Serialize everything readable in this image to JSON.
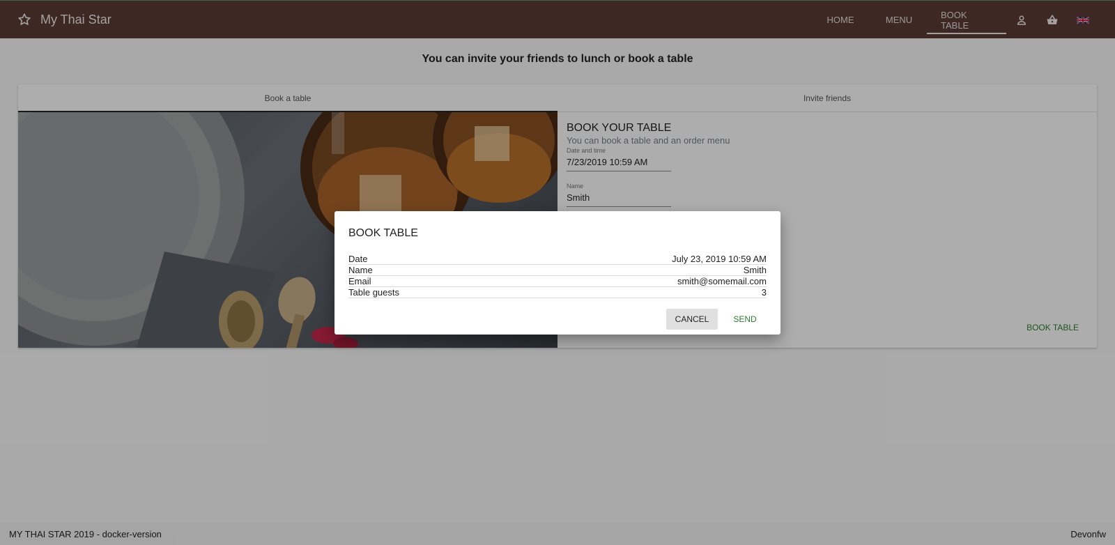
{
  "app": {
    "title": "My Thai Star",
    "nav": [
      "HOME",
      "MENU",
      "BOOK TABLE"
    ],
    "active_nav": "BOOK TABLE",
    "icons": [
      "star-icon",
      "account-icon",
      "basket-icon",
      "uk-flag-icon"
    ]
  },
  "page": {
    "headline": "You can invite your friends to lunch or book a table",
    "tabs": [
      "Book a table",
      "Invite friends"
    ],
    "active_tab": "Book a table"
  },
  "form": {
    "title": "BOOK YOUR TABLE",
    "subtitle": "You can book a table and an order menu",
    "date_label": "Date and time",
    "date_value": "7/23/2019 10:59 AM",
    "name_label": "Name",
    "name_value": "Smith",
    "book_button": "BOOK TABLE"
  },
  "dialog": {
    "title": "BOOK TABLE",
    "rows": [
      {
        "label": "Date",
        "value": "July 23, 2019 10:59 AM"
      },
      {
        "label": "Name",
        "value": "Smith"
      },
      {
        "label": "Email",
        "value": "smith@somemail.com"
      },
      {
        "label": "Table guests",
        "value": "3"
      }
    ],
    "cancel": "CANCEL",
    "send": "SEND"
  },
  "footer": {
    "left": "MY THAI STAR 2019 - docker-version",
    "right": "Devonfw"
  },
  "colors": {
    "topbar": "#5a3b36",
    "accent": "#2e7d32",
    "overlay": "rgba(0,0,0,0.32)"
  }
}
